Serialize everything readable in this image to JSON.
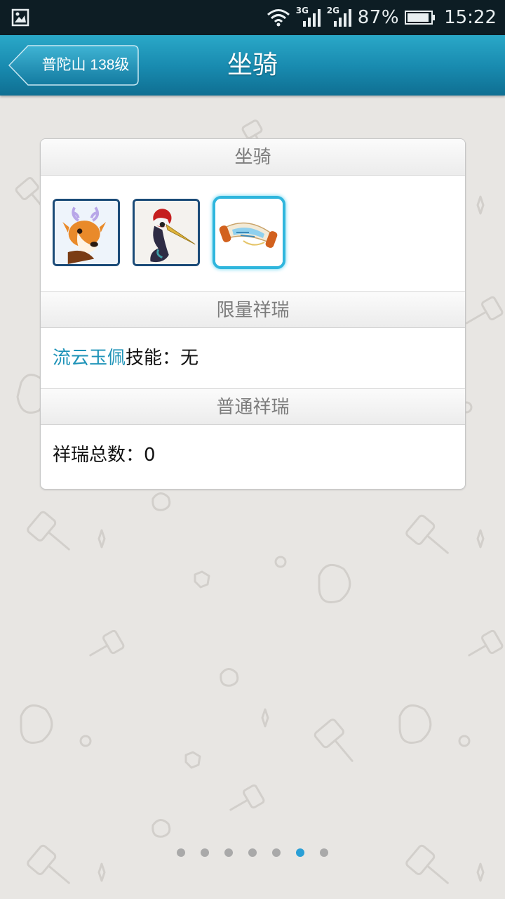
{
  "status_bar": {
    "network_a": "3G",
    "network_b": "2G",
    "battery": "87%",
    "time": "15:22",
    "icons": [
      "gallery-icon",
      "wifi-icon",
      "signal-icon",
      "battery-icon"
    ]
  },
  "header": {
    "back_label": "普陀山 138级",
    "title": "坐骑"
  },
  "mounts_section": {
    "title": "坐骑",
    "items": [
      {
        "name": "deer-mount-icon",
        "selected": false
      },
      {
        "name": "crane-mount-icon",
        "selected": false
      },
      {
        "name": "scroll-mount-icon",
        "selected": true
      }
    ]
  },
  "limited_section": {
    "title": "限量祥瑞",
    "item_link": "流云玉佩",
    "skill_label": "技能：",
    "skill_value": "无"
  },
  "normal_section": {
    "title": "普通祥瑞",
    "total_label": "祥瑞总数：",
    "total_value": "0"
  },
  "pager": {
    "count": 7,
    "active_index": 5
  },
  "colors": {
    "header": "#1889ae",
    "accent": "#2fb6dd",
    "link": "#1e93b8",
    "background": "#e8e6e3"
  }
}
